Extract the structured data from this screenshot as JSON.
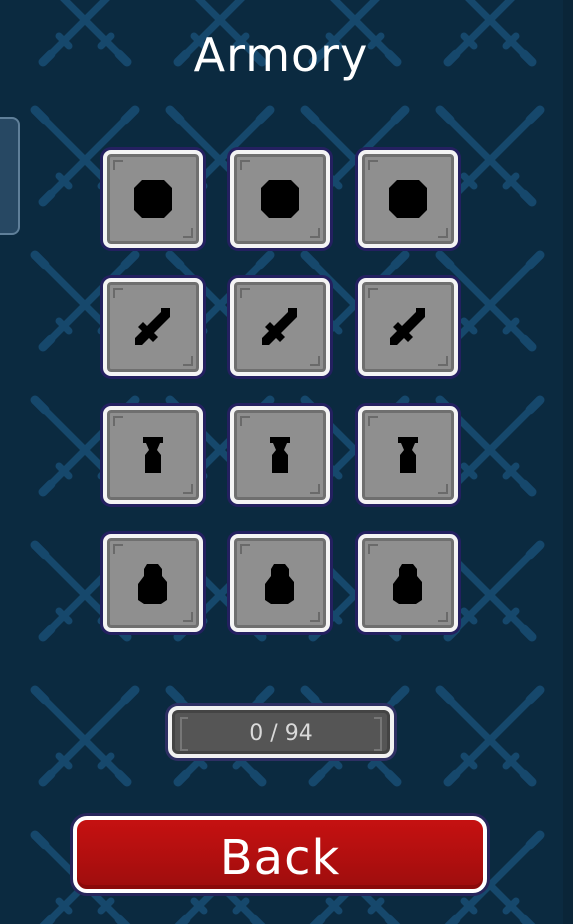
{
  "screen": {
    "title": "Armory",
    "background_color": "#0b2a40",
    "pattern_icon": "crossed-swords-icon",
    "pattern_color": "#1b4f78"
  },
  "slots": [
    {
      "icon": "round-helmet-icon",
      "label": ""
    },
    {
      "icon": "round-helmet-icon",
      "label": ""
    },
    {
      "icon": "round-helmet-icon",
      "label": ""
    },
    {
      "icon": "sword-icon",
      "label": ""
    },
    {
      "icon": "sword-icon",
      "label": ""
    },
    {
      "icon": "sword-icon",
      "label": ""
    },
    {
      "icon": "armor-icon",
      "label": ""
    },
    {
      "icon": "armor-icon",
      "label": ""
    },
    {
      "icon": "armor-icon",
      "label": ""
    },
    {
      "icon": "pouch-icon",
      "label": ""
    },
    {
      "icon": "pouch-icon",
      "label": ""
    },
    {
      "icon": "pouch-icon",
      "label": ""
    }
  ],
  "counter": {
    "text": "0 / 94"
  },
  "back_button": {
    "label": "Back",
    "color": "#b30f0f"
  }
}
